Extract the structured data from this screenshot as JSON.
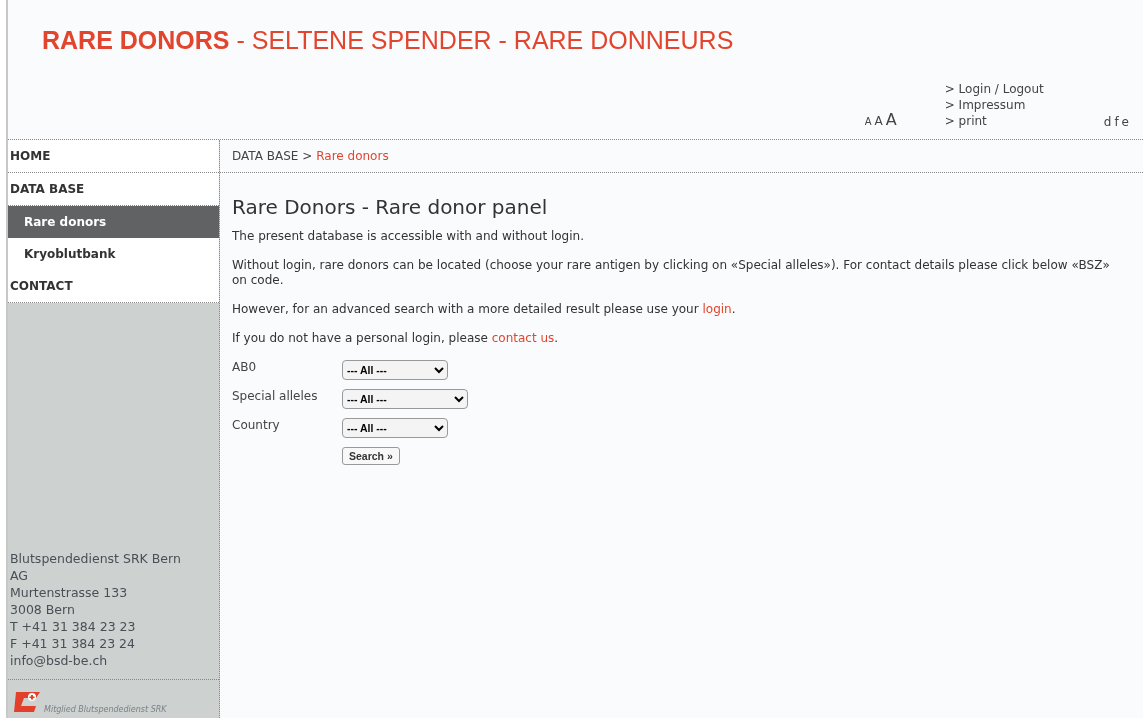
{
  "header": {
    "title": "**RARE DONORS** - SELTENE SPENDER - RARE DONNEURS",
    "font_sizes": [
      "A",
      "A",
      "A"
    ],
    "links": [
      "> Login / Logout",
      "> Impressum",
      "> print"
    ],
    "languages": [
      "d",
      "f",
      "e"
    ]
  },
  "sidebar": {
    "items": [
      {
        "label": "HOME",
        "selected": false
      },
      {
        "label": "DATA BASE",
        "selected": false,
        "children": [
          {
            "label": "Rare donors",
            "selected": true
          },
          {
            "label": "Kryoblutbank",
            "selected": false
          }
        ]
      },
      {
        "label": "CONTACT",
        "selected": false
      }
    ],
    "address": [
      "Blutspendedienst SRK Bern AG",
      "Murtenstrasse 133",
      "3008 Bern",
      "T +41 31 384 23 23",
      "F +41 31 384 23 24",
      "info@bsd-be.ch"
    ],
    "logo_caption": "Mitglied Blutspendedienst SRK"
  },
  "breadcrumb": {
    "parent": "DATA BASE >",
    "current": "Rare donors"
  },
  "content": {
    "heading": "Rare Donors - Rare donor panel",
    "paragraphs": [
      {
        "text": "The present database is accessible with and without login."
      },
      {
        "text": "Without login, rare donors can be located (choose your rare antigen by clicking on «Special alleles»). For contact details please click below «BSZ» on code."
      },
      {
        "text": "However, for an advanced search with a more detailed result please use your ",
        "link": "login",
        "end": "."
      },
      {
        "text": "If you do not have a personal login, please ",
        "link": "contact us",
        "end": "."
      }
    ],
    "fields": [
      {
        "label": "AB0",
        "value": "--- All ---",
        "kind": "short"
      },
      {
        "label": "Special alleles",
        "value": "--- All ---",
        "kind": "wide"
      },
      {
        "label": "Country",
        "value": "--- All ---",
        "kind": "short"
      }
    ],
    "search_button": "Search »"
  }
}
